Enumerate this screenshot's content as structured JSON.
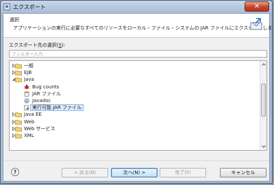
{
  "window": {
    "title": "エクスポート",
    "close_glyph": "✕"
  },
  "header": {
    "title": "選択",
    "description": "アプリケーションの実行に必要なすべてのリソースをローカル・ファイル・システムの JAR ファイルにエクスポートします。"
  },
  "filter": {
    "label_before": "エクスポート先の選択(",
    "label_mnemonic": "S",
    "label_after": "):",
    "placeholder": "フィルター入力",
    "value": ""
  },
  "tree": {
    "items": [
      {
        "label": "一般",
        "icon": "folder-icon",
        "expanded": false,
        "level": 0
      },
      {
        "label": "EJB",
        "icon": "folder-icon",
        "expanded": false,
        "level": 0
      },
      {
        "label": "Java",
        "icon": "folder-icon",
        "expanded": true,
        "level": 0
      },
      {
        "label": "Bug counts",
        "icon": "bug-icon",
        "level": 1
      },
      {
        "label": "JAR ファイル",
        "icon": "jar-icon",
        "level": 1
      },
      {
        "label": "Javadoc",
        "icon": "javadoc-icon",
        "level": 1
      },
      {
        "label": "実行可能 JAR ファイル",
        "icon": "runnable-jar-icon",
        "level": 1,
        "selected": true
      },
      {
        "label": "Java EE",
        "icon": "folder-icon",
        "expanded": false,
        "level": 0
      },
      {
        "label": "Web",
        "icon": "folder-icon",
        "expanded": false,
        "level": 0
      },
      {
        "label": "Web サービス",
        "icon": "folder-icon",
        "expanded": false,
        "level": 0
      },
      {
        "label": "XML",
        "icon": "folder-icon",
        "expanded": false,
        "level": 0
      }
    ]
  },
  "buttons": {
    "help": "?",
    "back": "< 戻る(B)",
    "next": "次へ(N) >",
    "finish": "完了(F)",
    "cancel": "キャンセル"
  },
  "colors": {
    "accent": "#3c7fb1",
    "folder": "#e8c66a",
    "selection": "#dcebfc"
  }
}
